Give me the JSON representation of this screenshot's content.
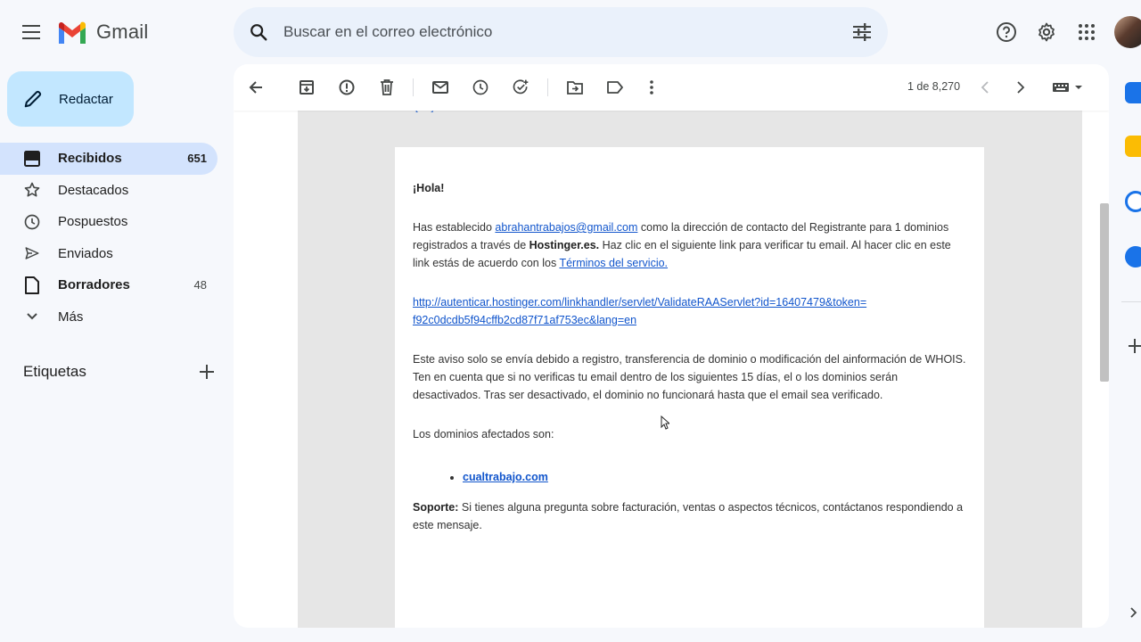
{
  "app": {
    "name": "Gmail"
  },
  "search": {
    "placeholder": "Buscar en el correo electrónico"
  },
  "compose": {
    "label": "Redactar"
  },
  "nav": [
    {
      "label": "Recibidos",
      "count": "651"
    },
    {
      "label": "Destacados",
      "count": ""
    },
    {
      "label": "Pospuestos",
      "count": ""
    },
    {
      "label": "Enviados",
      "count": ""
    },
    {
      "label": "Borradores",
      "count": "48"
    },
    {
      "label": "Más",
      "count": ""
    }
  ],
  "labels": {
    "title": "Etiquetas"
  },
  "toolbar": {
    "pager": "1 de 8,270"
  },
  "email": {
    "greeting": "¡Hola!",
    "p1_a": "Has establecido ",
    "p1_email": "abrahantrabajos@gmail.com",
    "p1_b": " como la dirección de contacto del Registrante para 1 dominios registrados a través de ",
    "p1_brand": "Hostinger.es.",
    "p1_c": " Haz clic en el siguiente link para verificar tu email. Al hacer clic en este link estás de acuerdo con los ",
    "p1_terms": "Términos del servicio.",
    "link_line1": "http://autenticar.hostinger.com/linkhandler/servlet/ValidateRAAServlet?id=16407479&token=",
    "link_line2": "f92c0dcdb5f94cffb2cd87f71af753ec&lang=en",
    "p2": "Este aviso solo se envía debido a registro, transferencia de dominio o modificación del ainformación de WHOIS. Ten en cuenta que si no verificas tu email dentro de los siguientes 15 días, el o los dominios serán desactivados. Tras ser desactivado, el dominio no funcionará hasta que el email sea verificado.",
    "p3": "Los dominios afectados son:",
    "domain": "cualtrabajo.com",
    "support_label": "Soporte:",
    "support_text": " Si tienes alguna pregunta sobre facturación, ventas o aspectos técnicos, contáctanos respondiendo a este mensaje."
  },
  "colors": {
    "accent": "#0b57d0",
    "compose_bg": "#c2e7ff",
    "active_nav": "#d3e3fd",
    "search_bg": "#eaf1fb",
    "link": "#1155cc"
  },
  "icons": [
    "menu-icon",
    "search-icon",
    "tune-icon",
    "help-icon",
    "settings-icon",
    "apps-icon",
    "pencil-icon",
    "inbox-icon",
    "star-icon",
    "clock-icon",
    "send-icon",
    "draft-icon",
    "chevron-down-icon",
    "plus-icon",
    "back-arrow-icon",
    "archive-icon",
    "report-icon",
    "trash-icon",
    "mail-icon",
    "snooze-icon",
    "add-task-icon",
    "move-icon",
    "label-icon",
    "more-icon",
    "chevron-left-icon",
    "chevron-right-icon",
    "keyboard-icon"
  ]
}
